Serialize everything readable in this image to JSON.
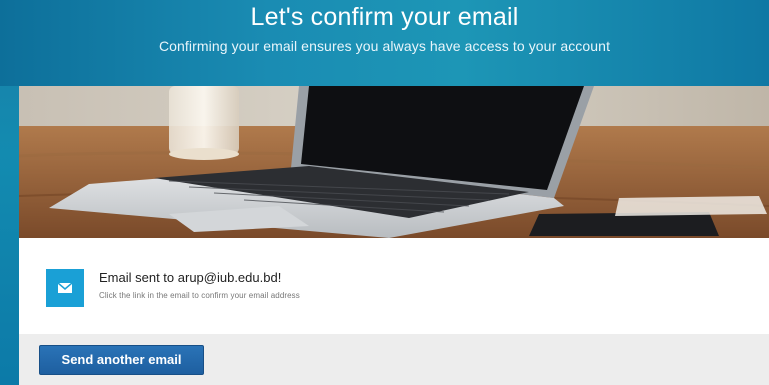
{
  "header": {
    "title": "Let's confirm your email",
    "subtitle": "Confirming your email ensures you always have access to your account"
  },
  "hero": {
    "image": "laptop-on-desk"
  },
  "notice": {
    "icon": "envelope-icon",
    "title": "Email sent to arup@iub.edu.bd!",
    "detail": "Click the link in the email to confirm your email address"
  },
  "footer": {
    "send_label": "Send another email"
  },
  "colors": {
    "header": "#1a8cb3",
    "badge": "#1aa0d6",
    "button": "#2467ab",
    "footer_bg": "#ededed"
  }
}
